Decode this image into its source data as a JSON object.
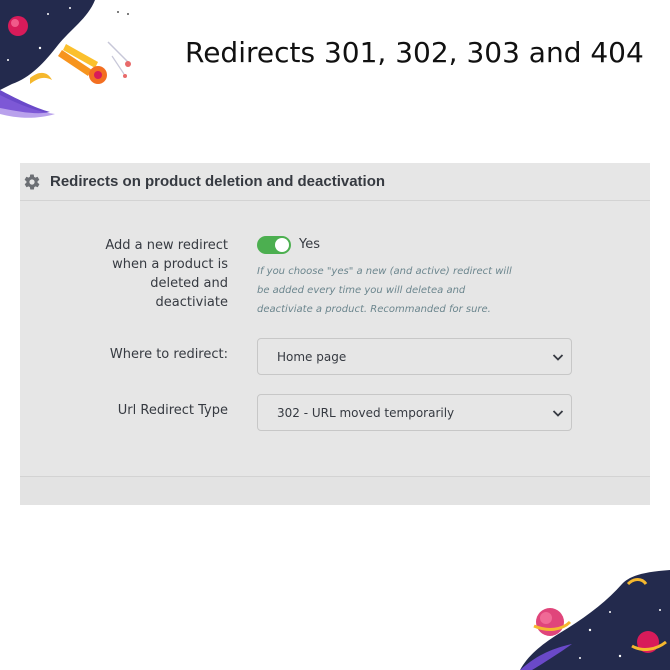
{
  "banner": {
    "title": "Redirects 301, 302, 303 and 404"
  },
  "panel": {
    "header_icon": "gear-icon",
    "title": "Redirects on product deletion and deactivation",
    "add_redirect": {
      "label": "Add a new redirect when a product is deleted and deactiviate",
      "toggle_on": true,
      "toggle_label": "Yes",
      "help": "If you choose \"yes\" a new (and active) redirect will be added every time you will deletea and deactiviate a product. Recommanded for sure."
    },
    "where_to_redirect": {
      "label": "Where to redirect:",
      "selected": "Home page"
    },
    "redirect_type": {
      "label": "Url Redirect Type",
      "selected": "302 - URL moved temporarily"
    }
  },
  "colors": {
    "panel_bg": "#e6e6e6",
    "toggle_on": "#4caf50",
    "text": "#363a41",
    "help_text": "#6c868e"
  }
}
